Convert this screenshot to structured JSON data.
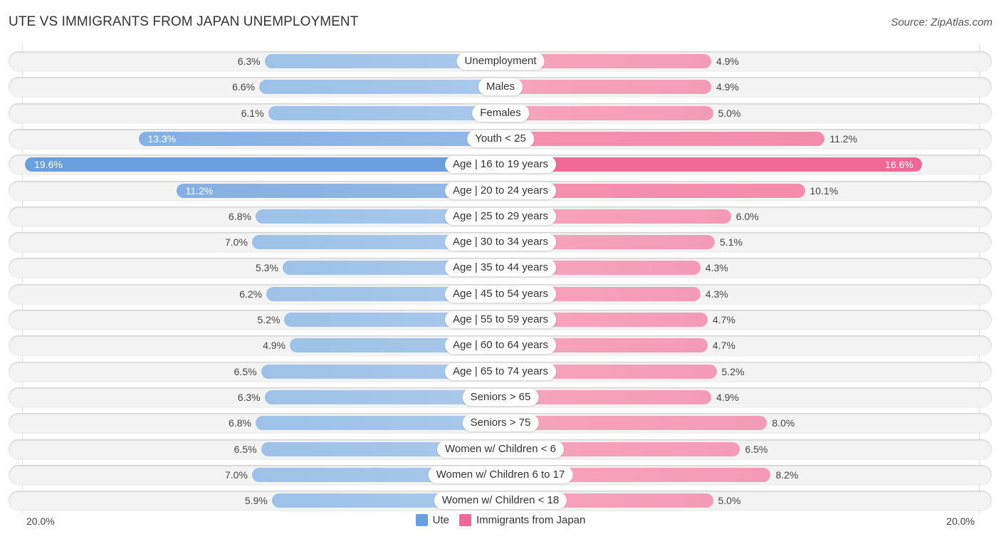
{
  "header": {
    "title": "UTE VS IMMIGRANTS FROM JAPAN UNEMPLOYMENT",
    "source": "Source: ZipAtlas.com"
  },
  "colors": {
    "ute": "#6a9fde",
    "japan": "#f06895"
  },
  "legend": [
    {
      "name": "Ute",
      "color": "#6a9fde"
    },
    {
      "name": "Immigrants from Japan",
      "color": "#f06895"
    }
  ],
  "axis": {
    "left_label": "20.0%",
    "right_label": "20.0%"
  },
  "chart_data": {
    "type": "bar",
    "orientation": "horizontal-diverging",
    "title": "UTE VS IMMIGRANTS FROM JAPAN UNEMPLOYMENT",
    "xlim": [
      0,
      20
    ],
    "legend_position": "bottom-center",
    "categories": [
      "Unemployment",
      "Males",
      "Females",
      "Youth < 25",
      "Age | 16 to 19 years",
      "Age | 20 to 24 years",
      "Age | 25 to 29 years",
      "Age | 30 to 34 years",
      "Age | 35 to 44 years",
      "Age | 45 to 54 years",
      "Age | 55 to 59 years",
      "Age | 60 to 64 years",
      "Age | 65 to 74 years",
      "Seniors > 65",
      "Seniors > 75",
      "Women w/ Children < 6",
      "Women w/ Children 6 to 17",
      "Women w/ Children < 18"
    ],
    "series": [
      {
        "name": "Ute",
        "side": "left",
        "values": [
          6.3,
          6.6,
          6.1,
          13.3,
          19.6,
          11.2,
          6.8,
          7.0,
          5.3,
          6.2,
          5.2,
          4.9,
          6.5,
          6.3,
          6.8,
          6.5,
          7.0,
          5.9
        ],
        "labels": [
          "6.3%",
          "6.6%",
          "6.1%",
          "13.3%",
          "19.6%",
          "11.2%",
          "6.8%",
          "7.0%",
          "5.3%",
          "6.2%",
          "5.2%",
          "4.9%",
          "6.5%",
          "6.3%",
          "6.8%",
          "6.5%",
          "7.0%",
          "5.9%"
        ]
      },
      {
        "name": "Immigrants from Japan",
        "side": "right",
        "values": [
          4.9,
          4.9,
          5.0,
          11.2,
          16.6,
          10.1,
          6.0,
          5.1,
          4.3,
          4.3,
          4.7,
          4.7,
          5.2,
          4.9,
          8.0,
          6.5,
          8.2,
          5.0
        ],
        "labels": [
          "4.9%",
          "4.9%",
          "5.0%",
          "11.2%",
          "16.6%",
          "10.1%",
          "6.0%",
          "5.1%",
          "4.3%",
          "4.3%",
          "4.7%",
          "4.7%",
          "5.2%",
          "4.9%",
          "8.0%",
          "6.5%",
          "8.2%",
          "5.0%"
        ]
      }
    ]
  }
}
